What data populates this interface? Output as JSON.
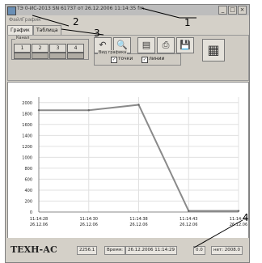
{
  "window": {
    "title": "ТЭ 0-ИС-2013 SN 61737 от 26.12.2006 11:14:35 fm",
    "controls": [
      "_",
      "□",
      "×"
    ]
  },
  "menu": [
    "Файл",
    "График"
  ],
  "tabs": [
    {
      "label": "График",
      "active": true
    },
    {
      "label": "Таблица",
      "active": false
    }
  ],
  "toolbar": {
    "channels_label": "Канал",
    "channels": [
      "1",
      "2",
      "3",
      "4"
    ],
    "tools": [
      {
        "icon": "undo-icon",
        "glyph": "↶"
      },
      {
        "icon": "zoom-icon",
        "glyph": "🔍"
      },
      {
        "icon": "document-icon",
        "glyph": "▤"
      },
      {
        "icon": "print-icon",
        "glyph": "⎙"
      },
      {
        "icon": "save-icon",
        "glyph": "💾"
      },
      {
        "icon": "table-view-icon",
        "glyph": "▦"
      }
    ],
    "view_label": "Вид графика",
    "view_points_label": "точки",
    "view_lines_label": "линии",
    "view_points_checked": true,
    "view_lines_checked": true
  },
  "chart_data": {
    "type": "line",
    "x": [
      "11:14:28\n26.12.06",
      "11:14:30\n26.12.06",
      "11:14:38\n26.12.06",
      "11:14:43\n26.12.06",
      "11:14:48\n26.12.06"
    ],
    "series": [
      {
        "values": [
          1860,
          1860,
          1960,
          20,
          20
        ]
      }
    ],
    "yticks": [
      2000,
      1800,
      1600,
      1400,
      1200,
      1000,
      800,
      600,
      400,
      200,
      0
    ],
    "ylim": [
      0,
      2100
    ],
    "grid": true,
    "line_color": "#8a8a8a"
  },
  "status": {
    "brand": "ТЕХН-АС",
    "code": "2256.1",
    "time_label": "Время:",
    "time_value": "26.12.2006 11:14:29",
    "value": "0.0",
    "extra": "нет: 2008.0"
  },
  "annotations": [
    "1",
    "2",
    "3",
    "4"
  ]
}
